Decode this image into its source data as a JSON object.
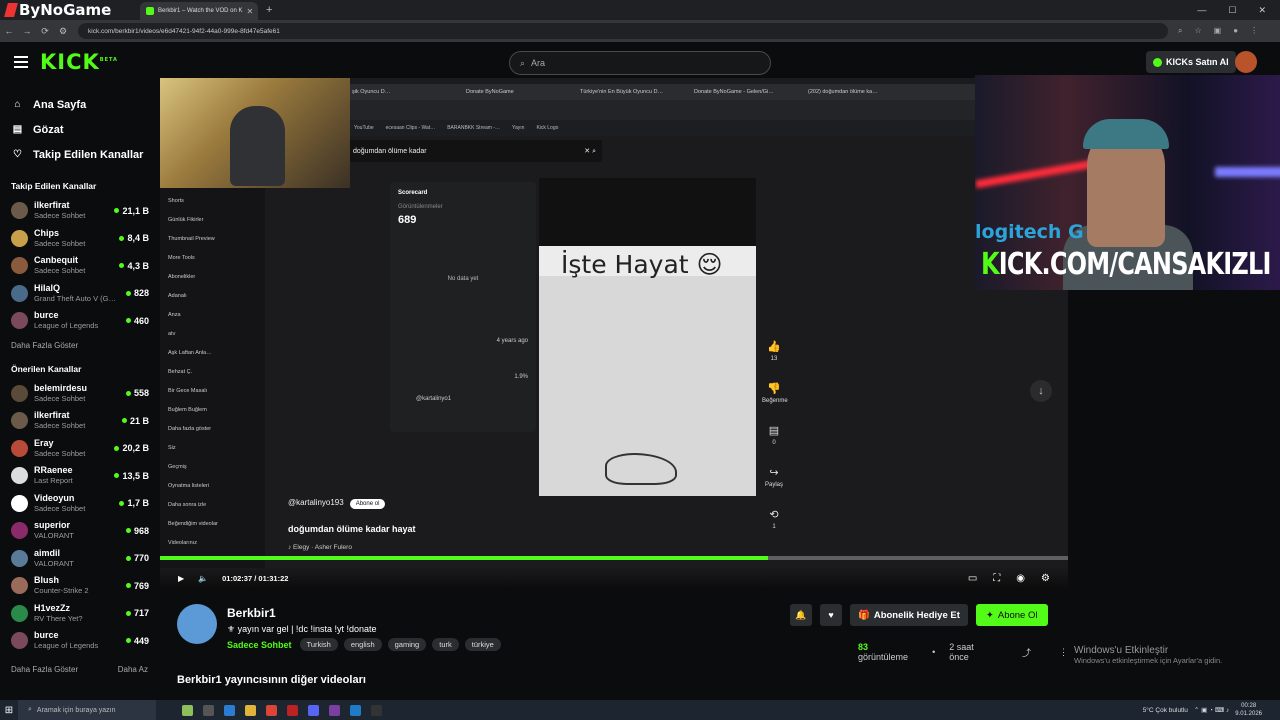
{
  "browser": {
    "brand": "ByNoGame",
    "tabs": [
      {
        "label": "Berkbir1 – Watch the VOD on K"
      }
    ],
    "url": "kick.com/berkbir1/videos/e6d47421-94f2-44a0-999e-8fd47e5afe61"
  },
  "kick": {
    "logo": "KICK",
    "logo_sup": "BETA",
    "search_placeholder": "Ara",
    "buy_kicks": "KICKs Satın Al"
  },
  "sidebar": {
    "nav": [
      {
        "label": "Ana Sayfa",
        "icon": "home-icon"
      },
      {
        "label": "Gözat",
        "icon": "browse-icon"
      },
      {
        "label": "Takip Edilen Kanallar",
        "icon": "heart-icon"
      }
    ],
    "followed_title": "Takip Edilen Kanallar",
    "followed": [
      {
        "name": "ilkerfirat",
        "category": "Sadece Sohbet",
        "viewers": "21,1 B",
        "color": "#6b5a4a"
      },
      {
        "name": "Chips",
        "category": "Sadece Sohbet",
        "viewers": "8,4 B",
        "color": "#c9a04a"
      },
      {
        "name": "Canbequit",
        "category": "Sadece Sohbet",
        "viewers": "4,3 B",
        "color": "#8a5a3c"
      },
      {
        "name": "HilalQ",
        "category": "Grand Theft Auto V (G…",
        "viewers": "828",
        "color": "#4a6a8a"
      },
      {
        "name": "burce",
        "category": "League of Legends",
        "viewers": "460",
        "color": "#7a4a5a"
      }
    ],
    "show_more": "Daha Fazla Göster",
    "recommended_title": "Önerilen Kanallar",
    "recommended": [
      {
        "name": "belemirdesu",
        "category": "Sadece Sohbet",
        "viewers": "558",
        "color": "#5a4a3a"
      },
      {
        "name": "ilkerfirat",
        "category": "Sadece Sohbet",
        "viewers": "21 B",
        "color": "#6b5a4a"
      },
      {
        "name": "Eray",
        "category": "Sadece Sohbet",
        "viewers": "20,2 B",
        "color": "#b84a3a"
      },
      {
        "name": "RRaenee",
        "category": "Last Report",
        "viewers": "13,5 B",
        "color": "#dddddd"
      },
      {
        "name": "Videoyun",
        "category": "Sadece Sohbet",
        "viewers": "1,7 B",
        "color": "#ffffff"
      },
      {
        "name": "superior",
        "category": "VALORANT",
        "viewers": "968",
        "color": "#8a2a6a"
      },
      {
        "name": "aimdil",
        "category": "VALORANT",
        "viewers": "770",
        "color": "#5a7a9a"
      },
      {
        "name": "Blush",
        "category": "Counter-Strike 2",
        "viewers": "769",
        "color": "#9a6a5a"
      },
      {
        "name": "H1vezZz",
        "category": "RV There Yet?",
        "viewers": "717",
        "color": "#2a8a4a"
      },
      {
        "name": "burce",
        "category": "League of Legends",
        "viewers": "449",
        "color": "#7a4a5a"
      }
    ],
    "show_more_2": "Daha Fazla Göster",
    "show_less": "Daha Az"
  },
  "player": {
    "inner_tabs": [
      "şik Oyuncu D…",
      "Donate ByNoGame",
      "Türkiye'nin En Büyük Oyuncu D…",
      "Donate ByNoGame - Gelen/Gi…",
      "(202) doğumdan ölüme ka…"
    ],
    "inner_bookmarks": [
      "YouTube",
      "ecesaan Clips - Wat…",
      "BARANBKK Stream -…",
      "Yayın",
      "Kick Logo"
    ],
    "inner_search": "doğumdan ölüme kadar",
    "inner_sidebar": [
      "Shorts",
      "Günlük Fikirler",
      "Thumbnail Preview",
      "More Tools",
      "Abonelikler",
      "Adanalı",
      "Anza",
      "atv",
      "Aşk Laftan Anla…",
      "Behzat Ç.",
      "Bir Gece Masalı",
      "Buğlem Buğlem",
      "Daha fazla göster",
      "Siz",
      "Geçmiş",
      "Oynatma listeleri",
      "Daha sonra izle",
      "Beğendiğim videolar",
      "Videolarınız"
    ],
    "scorecard_title": "Scorecard",
    "scorecard_label": "Görüntülenmeler",
    "scorecard_value": "689",
    "scorecard_nodata": "No data yet",
    "scorecard_uploaded": "4 years ago",
    "scorecard_engagement": "1.9%",
    "scorecard_user": "@kartalinyo1",
    "short_caption": "İşte Hayat 😌",
    "rail": [
      {
        "icon": "like-icon",
        "label": "13"
      },
      {
        "icon": "dislike-icon",
        "label": "Beğenme"
      },
      {
        "icon": "comment-icon",
        "label": "0"
      },
      {
        "icon": "share-icon",
        "label": "Paylaş"
      },
      {
        "icon": "remix-icon",
        "label": "1"
      }
    ],
    "short_channel": "@kartalinyo193",
    "short_subscribe": "Abone ol",
    "short_title": "doğumdan ölüme kadar hayat",
    "short_song": "♪ Elegy · Asher Fulero",
    "stream_brand": "logitech G",
    "stream_url_k": "K",
    "stream_url": "ICK.COM/CANSAKIZLI",
    "progress": 0.67,
    "time_current": "01:02:37",
    "time_total": "01:31:22"
  },
  "channel": {
    "name": "Berkbir1",
    "title": "⚜ yayın var gel | !dc !insta !yt !donate",
    "category": "Sadece Sohbet",
    "tags": [
      "Turkish",
      "english",
      "gaming",
      "turk",
      "türkiye"
    ],
    "gift_label": "Abonelik Hediye Et",
    "subscribe_label": "Abone Ol",
    "views": "83",
    "views_label": "görüntüleme",
    "time_ago": "2 saat önce"
  },
  "other_videos": "Berkbir1 yayıncısının diğer videoları",
  "windows": {
    "activate_title": "Windows'u Etkinleştir",
    "activate_sub": "Windows'u etkinleştirmek için Ayarlar'a gidin.",
    "search": "Aramak için buraya yazın",
    "weather": "5°C  Çok bulutlu",
    "time": "00:28",
    "date": "9.01.2026"
  }
}
